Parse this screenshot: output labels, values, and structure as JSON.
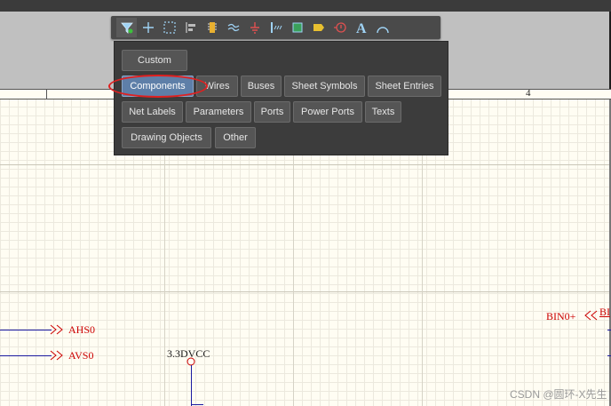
{
  "toolbar": {
    "icons": [
      "filter-icon",
      "crosshair-icon",
      "select-rect-icon",
      "align-icon",
      "component-icon",
      "wire-icon",
      "ground-icon",
      "bus-icon",
      "sheet-symbol-icon",
      "port-icon",
      "no-erc-icon",
      "text-icon",
      "arc-icon"
    ]
  },
  "filter_panel": {
    "chips": [
      {
        "label": "Custom"
      },
      {
        "label": "Components"
      },
      {
        "label": "Wires"
      },
      {
        "label": "Buses"
      },
      {
        "label": "Sheet Symbols"
      },
      {
        "label": "Sheet Entries"
      },
      {
        "label": "Net Labels"
      },
      {
        "label": "Parameters"
      },
      {
        "label": "Ports"
      },
      {
        "label": "Power Ports"
      },
      {
        "label": "Texts"
      },
      {
        "label": "Drawing Objects"
      },
      {
        "label": "Other"
      }
    ],
    "selected": "Components"
  },
  "sheet": {
    "zone_label": "4",
    "ports": [
      {
        "label": "AHS0"
      },
      {
        "label": "AVS0"
      },
      {
        "label": "BIN0+"
      },
      {
        "label": "BI"
      }
    ],
    "power_label": "3.3DVCC"
  },
  "watermark": "CSDN @圆环-X先生",
  "colors": {
    "accent": "#5e7fa8",
    "highlight": "#e02020",
    "net_label": "#cc0000",
    "wire": "#1a1aa0"
  }
}
